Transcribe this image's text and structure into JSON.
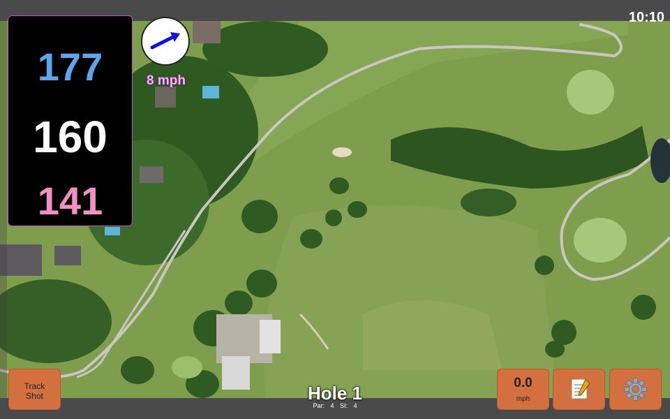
{
  "status_bar": {
    "time": "10:10"
  },
  "distances": {
    "back": "177",
    "middle": "160",
    "front": "141"
  },
  "wind": {
    "speed_label": "8 mph",
    "direction_icon": "arrow-icon"
  },
  "buttons": {
    "track_shot_line1": "Track",
    "track_shot_line2": "Shot",
    "speed_value": "0.0",
    "speed_unit": "mph",
    "notes_icon": "notepad-icon",
    "settings_icon": "gear-icon"
  },
  "hole": {
    "title": "Hole 1",
    "par": "Par: 4",
    "si": "SI: 4"
  },
  "colors": {
    "back_distance": "#5aa7f0",
    "middle_distance": "#ffffff",
    "front_distance": "#f48fc6",
    "button": "#d4703f",
    "wind_label": "#f2b8f0"
  }
}
